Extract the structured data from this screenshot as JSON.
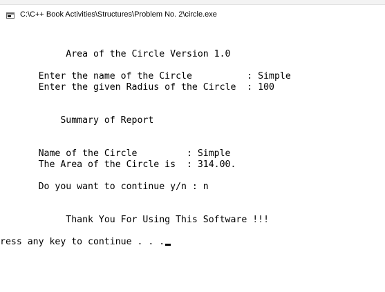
{
  "window": {
    "title": "C:\\C++ Book Activities\\Structures\\Problem No. 2\\circle.exe",
    "icon": "console-app-icon"
  },
  "console": {
    "lines": [
      "",
      "",
      "            Area of the Circle Version 1.0",
      "",
      "       Enter the name of the Circle          : Simple",
      "       Enter the given Radius of the Circle  : 100",
      "",
      "",
      "           Summary of Report",
      "",
      "",
      "       Name of the Circle         : Simple",
      "       The Area of the Circle is  : 314.00.",
      "",
      "       Do you want to continue y/n : n",
      "",
      "",
      "            Thank You For Using This Software !!!",
      "",
      "ress any key to continue . . ."
    ],
    "cursor": "blinking-underscore-cursor"
  },
  "colors": {
    "background": "#ffffff",
    "text": "#000000"
  }
}
